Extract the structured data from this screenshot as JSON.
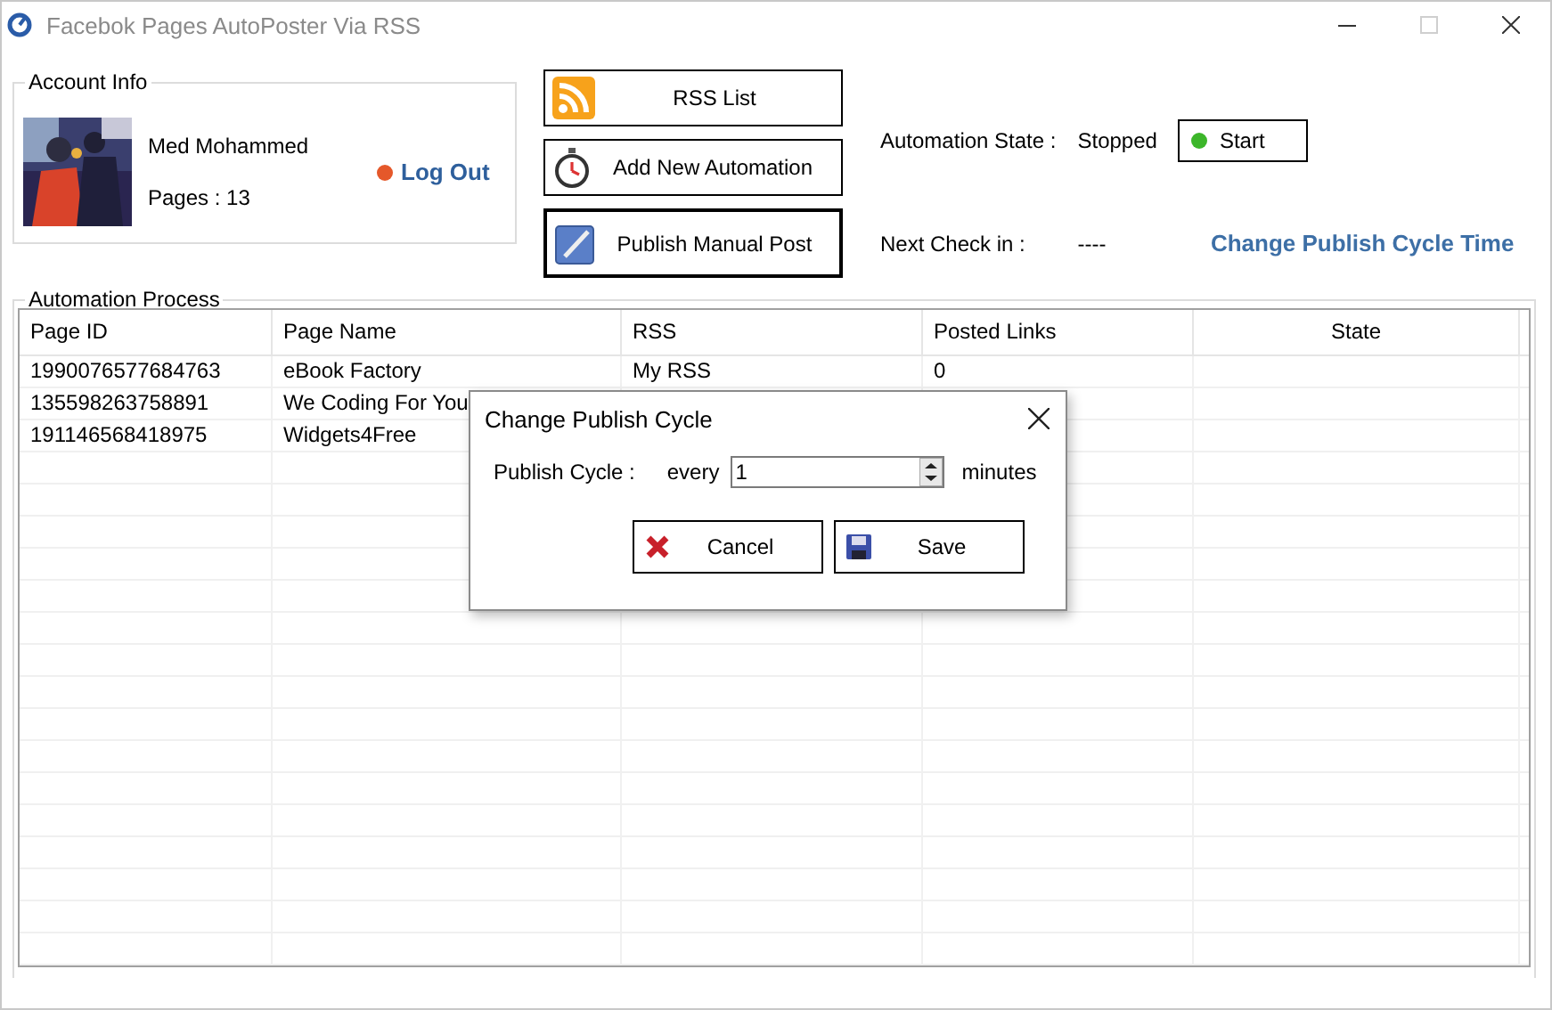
{
  "window": {
    "title": "Facebok Pages AutoPoster Via RSS",
    "controls": [
      {
        "kind": "minimize",
        "disabled": false
      },
      {
        "kind": "maximize",
        "disabled": true
      },
      {
        "kind": "close",
        "disabled": false
      }
    ]
  },
  "account_info": {
    "title": "Account Info",
    "name": "Med Mohammed",
    "pages": "Pages : 13",
    "logout": "Log Out"
  },
  "actions": [
    {
      "label": "RSS List",
      "kind": "rss",
      "focused": false
    },
    {
      "label": "Add New Automation",
      "kind": "stopwatch",
      "focused": false
    },
    {
      "label": "Publish Manual Post",
      "kind": "edit",
      "focused": true
    }
  ],
  "automation": {
    "state_label": "Automation State :",
    "state": "Stopped",
    "start_button": "Start",
    "next_label": "Next Check in :",
    "next_value": "----",
    "change_link": "Change Publish Cycle Time"
  },
  "process": {
    "title": "Automation Process",
    "columns": [
      "Page ID",
      "Page Name",
      "RSS",
      "Posted Links",
      "State"
    ],
    "rows": [
      {
        "cells": [
          "1990076577684763",
          "eBook Factory",
          "My RSS",
          "0"
        ]
      },
      {
        "cells": [
          "135598263758891",
          "We Coding For You"
        ]
      },
      {
        "cells": [
          "191146568418975",
          "Widgets4Free"
        ]
      }
    ]
  },
  "dialog": {
    "title": "Change Publish Cycle",
    "field_label": "Publish Cycle :",
    "prefix": "every",
    "value": "1",
    "suffix": "minutes",
    "buttons": [
      {
        "label": "Cancel",
        "kind": "cancel"
      },
      {
        "label": "Save",
        "kind": "save"
      }
    ]
  }
}
